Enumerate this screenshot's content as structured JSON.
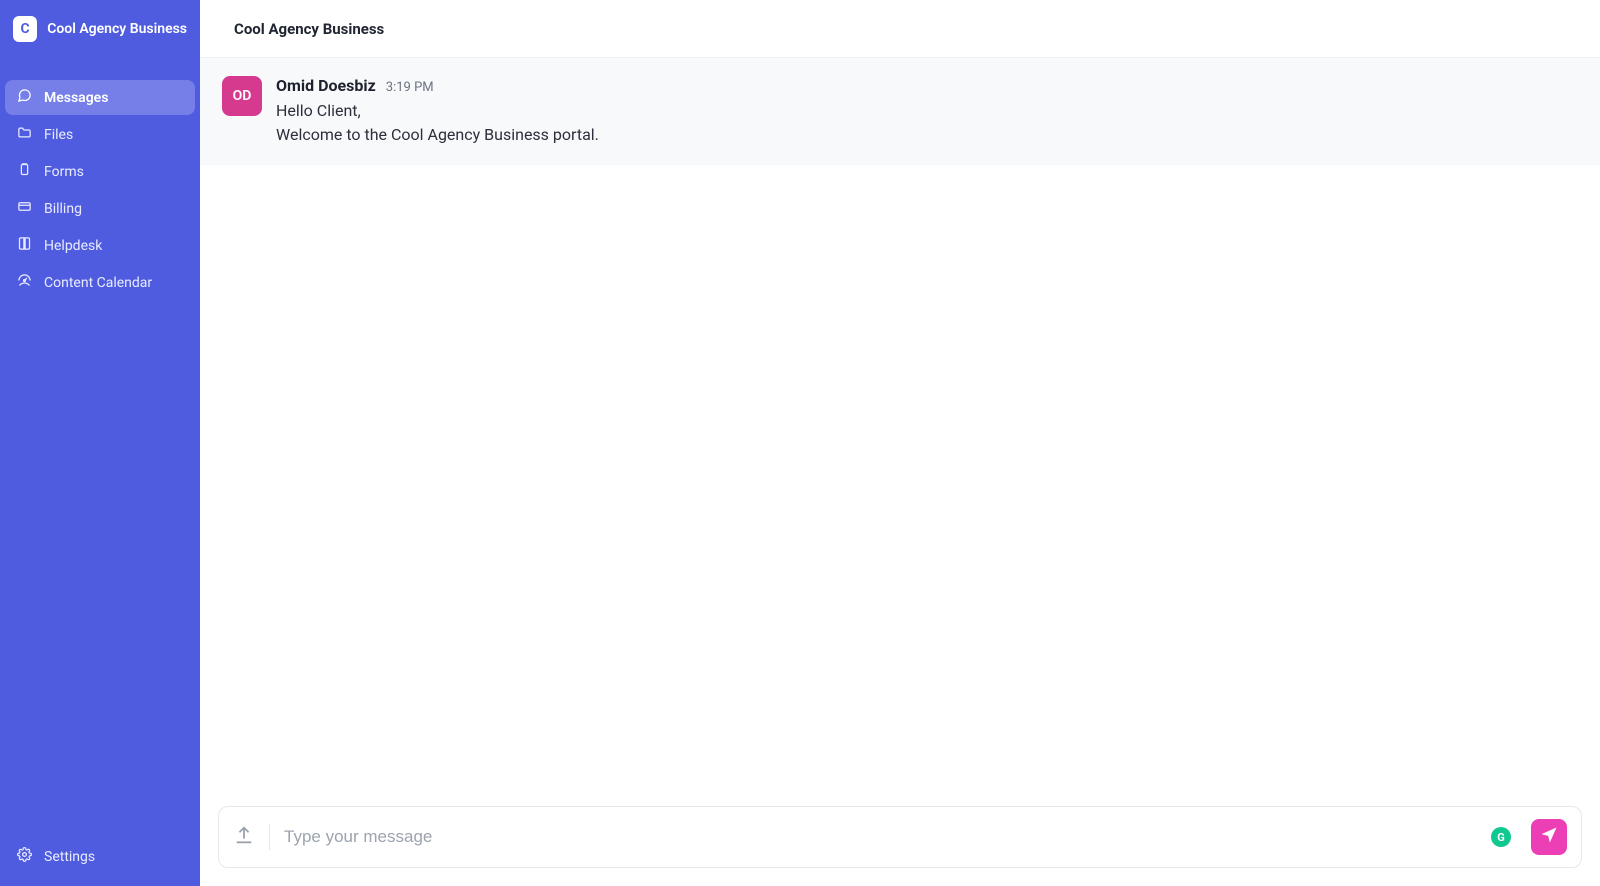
{
  "brand": {
    "logo_letter": "C",
    "name": "Cool Agency Business"
  },
  "sidebar": {
    "items": [
      {
        "label": "Messages",
        "icon": "chat-icon"
      },
      {
        "label": "Files",
        "icon": "folder-icon"
      },
      {
        "label": "Forms",
        "icon": "clipboard-icon"
      },
      {
        "label": "Billing",
        "icon": "card-icon"
      },
      {
        "label": "Helpdesk",
        "icon": "book-icon"
      },
      {
        "label": "Content Calendar",
        "icon": "gauge-icon"
      }
    ],
    "settings_label": "Settings"
  },
  "header": {
    "title": "Cool Agency Business"
  },
  "thread": {
    "messages": [
      {
        "avatar_initials": "OD",
        "author": "Omid Doesbiz",
        "time": "3:19 PM",
        "text": "Hello Client,\nWelcome to the Cool Agency Business portal."
      }
    ]
  },
  "composer": {
    "placeholder": "Type your message",
    "grammarly_label": "G"
  },
  "colors": {
    "sidebar_bg": "#4f5ce0",
    "accent_pink": "#ec3fb6",
    "avatar_bg": "#d63a8e",
    "grammarly": "#10c890"
  }
}
